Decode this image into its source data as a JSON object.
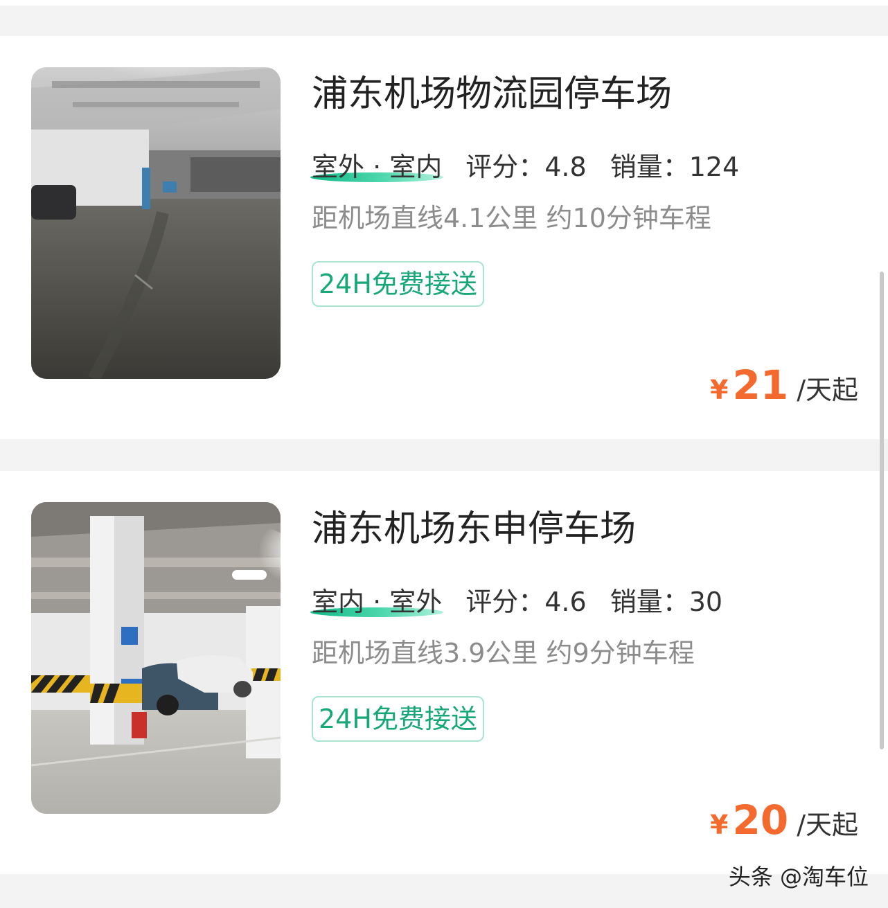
{
  "listings": [
    {
      "name": "浦东机场物流园停车场",
      "type": "室外 · 室内",
      "rating": "评分：4.8",
      "sales": "销量：124",
      "distance": "距机场直线4.1公里 约10分钟车程",
      "tag": "24H免费接送",
      "currency": "¥",
      "price": "21",
      "unit": "/天起"
    },
    {
      "name": "浦东机场东申停车场",
      "type": "室内 · 室外",
      "rating": "评分：4.6",
      "sales": "销量：30",
      "distance": "距机场直线3.9公里 约9分钟车程",
      "tag": "24H免费接送",
      "currency": "¥",
      "price": "20",
      "unit": "/天起"
    }
  ],
  "watermark": "头条 @淘车位",
  "colors": {
    "accent_green": "#17a779",
    "price_orange": "#f46a2e"
  }
}
